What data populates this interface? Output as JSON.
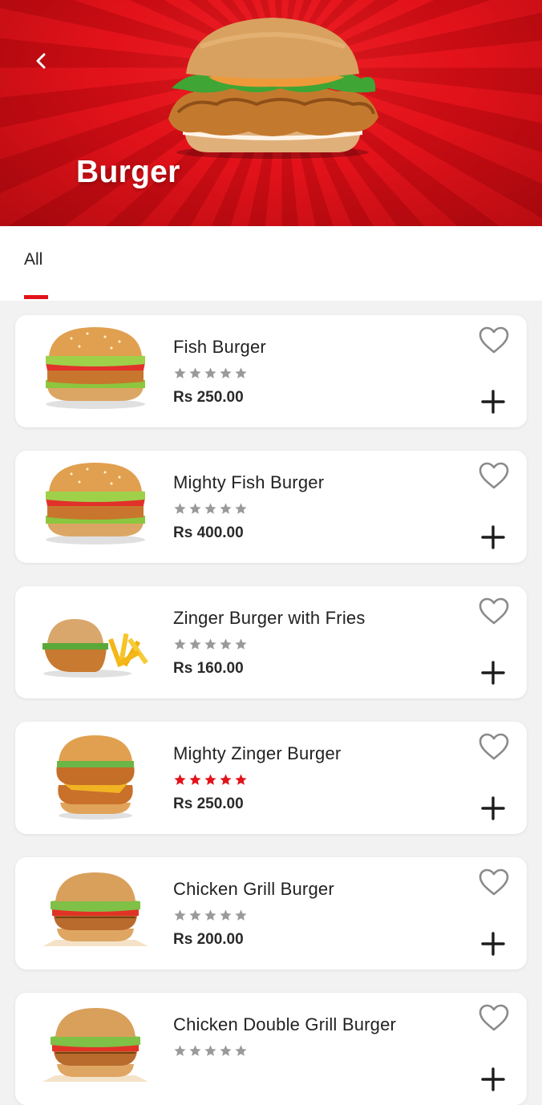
{
  "header": {
    "title": "Burger",
    "back_icon": "chevron-left-icon",
    "hero_image": "burger-hero-image"
  },
  "tabs": [
    {
      "label": "All",
      "active": true
    }
  ],
  "colors": {
    "accent": "#e3121a",
    "star_inactive": "#9a9a9a",
    "star_active": "#e3121a"
  },
  "items": [
    {
      "name": "Fish Burger",
      "price": "Rs 250.00",
      "rating": 0,
      "image": "fish-burger-image"
    },
    {
      "name": "Mighty Fish Burger",
      "price": "Rs 400.00",
      "rating": 0,
      "image": "fish-burger-image"
    },
    {
      "name": "Zinger Burger with Fries",
      "price": "Rs 160.00",
      "rating": 0,
      "image": "zinger-fries-image"
    },
    {
      "name": "Mighty Zinger Burger",
      "price": "Rs 250.00",
      "rating": 5,
      "image": "mighty-zinger-image"
    },
    {
      "name": "Chicken Grill Burger",
      "price": "Rs 200.00",
      "rating": 0,
      "image": "grill-burger-image"
    },
    {
      "name": "Chicken Double Grill Burger",
      "price": "",
      "rating": 0,
      "image": "grill-burger-image"
    }
  ]
}
